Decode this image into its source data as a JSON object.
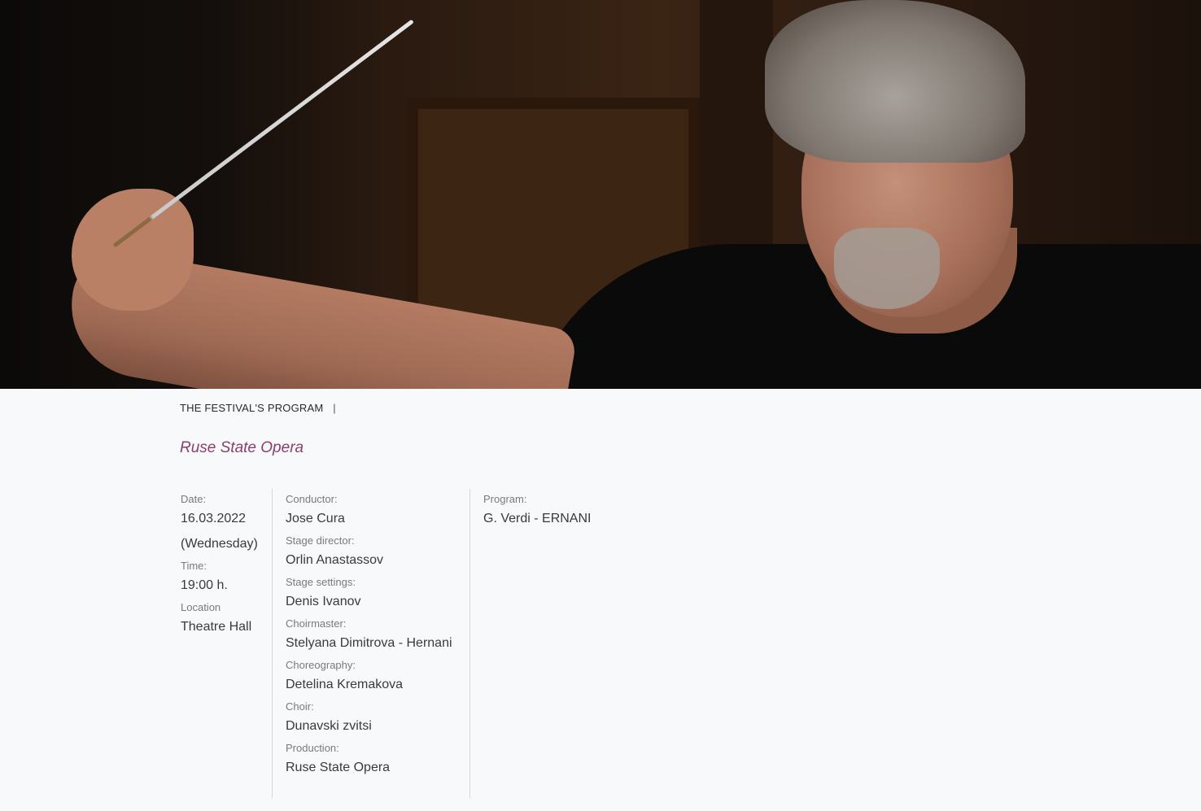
{
  "breadcrumb": {
    "section": "THE FESTIVAL'S PROGRAM",
    "separator": "|"
  },
  "event": {
    "title": "Ruse State Opera"
  },
  "info": {
    "date_label": "Date:",
    "date_value": "16.03.2022",
    "weekday": "(Wednesday)",
    "time_label": "Time:",
    "time_value": "19:00 h.",
    "location_label": "Location",
    "location_value": "Theatre Hall"
  },
  "credits": [
    {
      "label": "Conductor:",
      "value": "Jose Cura"
    },
    {
      "label": "Stage director:",
      "value": "Orlin Anastassov"
    },
    {
      "label": "Stage settings:",
      "value": "Denis Ivanov"
    },
    {
      "label": "Choirmaster:",
      "value": "Stelyana Dimitrova - Hernani"
    },
    {
      "label": "Choreography:",
      "value": "Detelina Kremakova"
    },
    {
      "label": "Choir:",
      "value": "Dunavski zvitsi"
    },
    {
      "label": "Production:",
      "value": "Ruse State Opera"
    }
  ],
  "program": {
    "label": "Program:",
    "value": "G. Verdi - ERNANI"
  },
  "colors": {
    "title_accent": "#8a3f6c",
    "background": "#f8f9fb"
  }
}
